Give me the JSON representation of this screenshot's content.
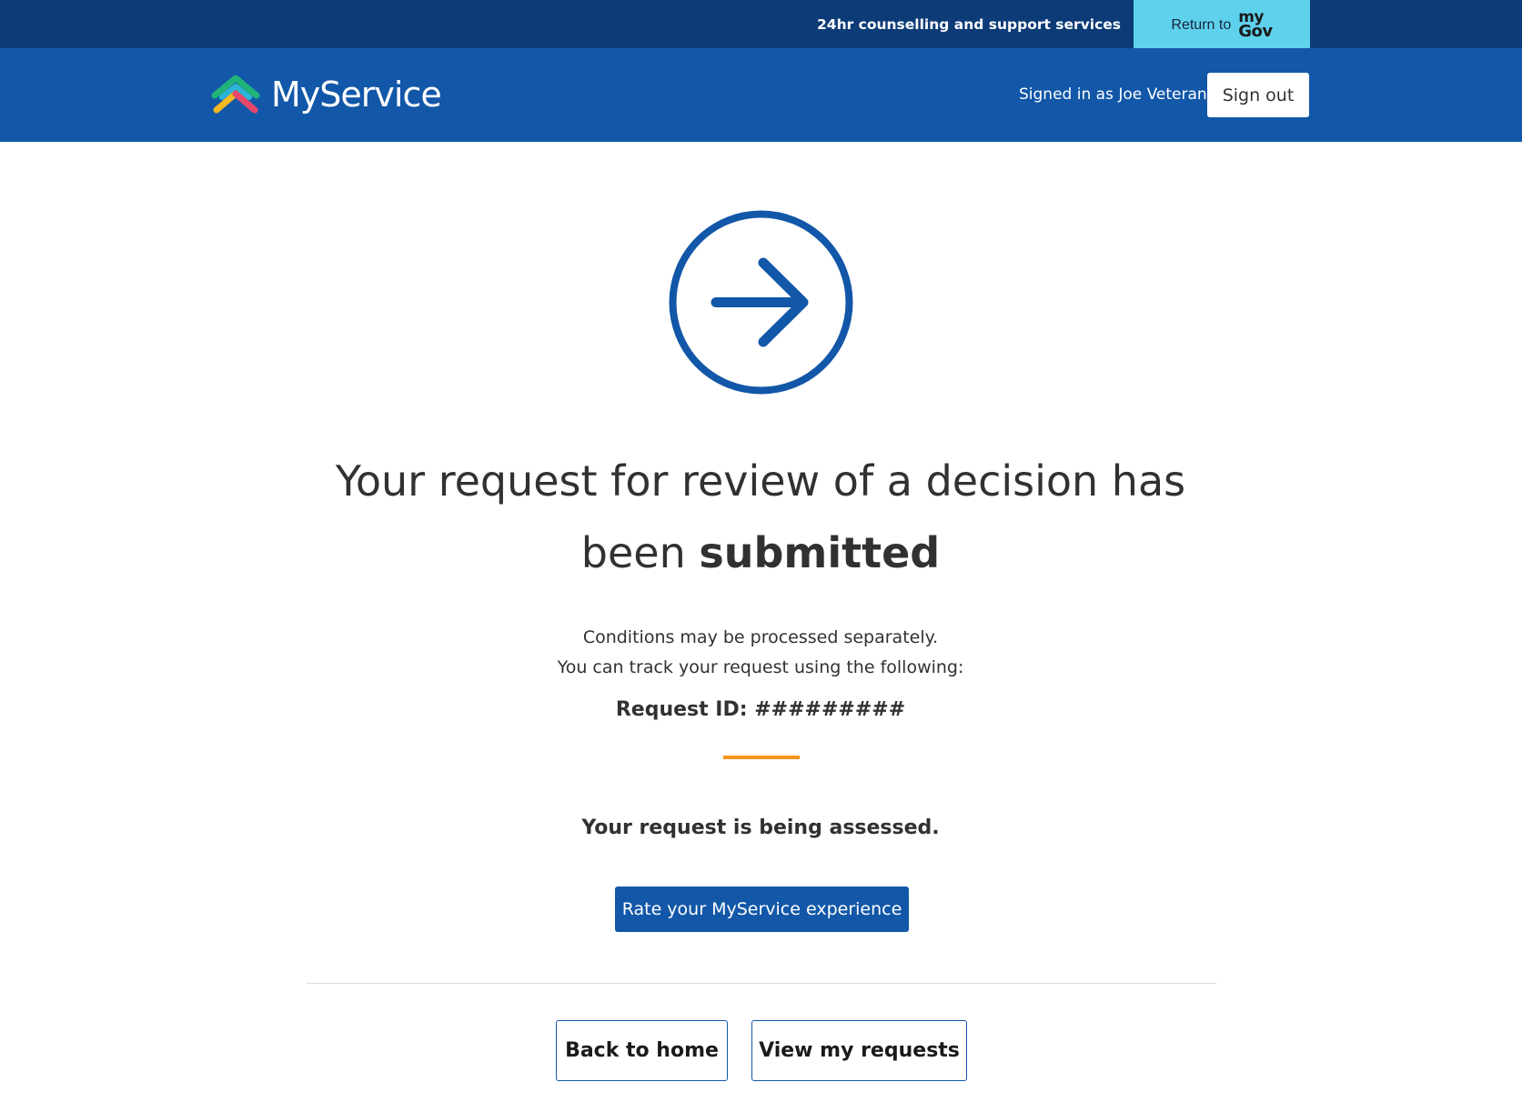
{
  "topbar": {
    "counselling_label": "24hr counselling and support services",
    "return_label": "Return to",
    "mygov_logo_top": "my",
    "mygov_logo_bottom": "Gov"
  },
  "header": {
    "brand_name": "MyService",
    "signed_in_text": "Signed in as Joe Veteran",
    "signout_label": "Sign out"
  },
  "main": {
    "status_icon": "arrow-right-circle-icon",
    "headline_part1": "Your request for review of a decision has been",
    "headline_emphasis": "submitted",
    "desc_line1": "Conditions may be processed separately.",
    "desc_line2": "You can track your request using the following:",
    "request_id_label": "Request ID:",
    "request_id_value": "#########",
    "assessment_status": "Your request is being assessed.",
    "rate_button_label": "Rate your MyService experience",
    "back_home_label": "Back to home",
    "view_requests_label": "View my requests"
  },
  "colors": {
    "topbar_bg": "#0d3b78",
    "header_bg": "#1257a8",
    "mygov_button_bg": "#5ed1ec",
    "accent_orange": "#f7941d",
    "primary_blue": "#1257a8",
    "text": "#313131"
  }
}
